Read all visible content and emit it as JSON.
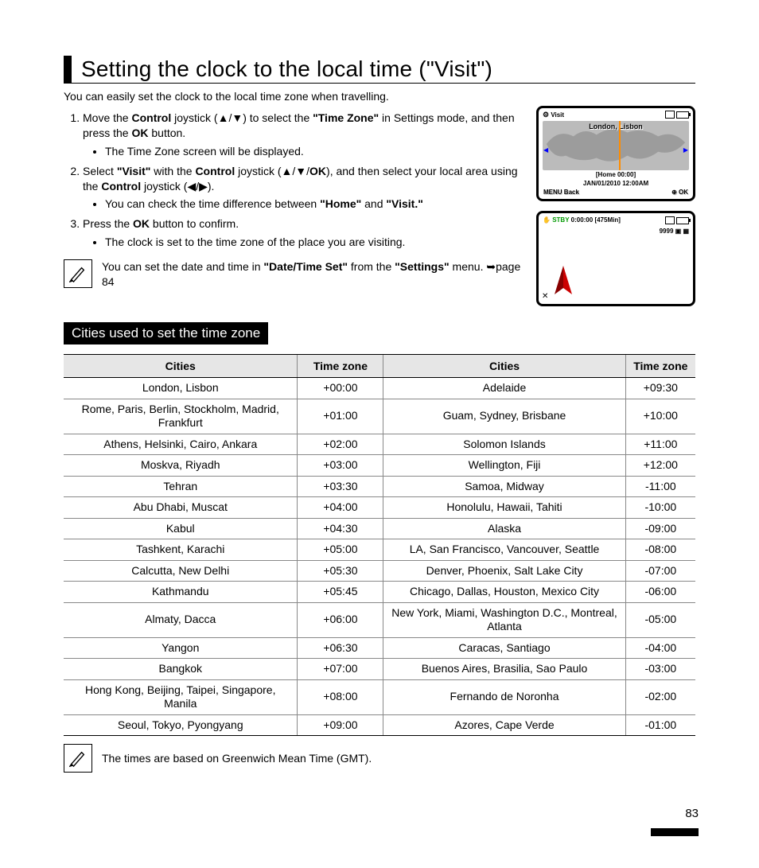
{
  "title": "Setting the clock to the local time (\"Visit\")",
  "intro": "You can easily set the clock to the local time zone when travelling.",
  "steps": {
    "s1_a": "Move the ",
    "s1_b": "Control",
    "s1_c": " joystick (▲/▼) to select the ",
    "s1_d": "\"Time Zone\"",
    "s1_e": " in Settings mode, and then press the ",
    "s1_f": "OK",
    "s1_g": " button.",
    "s1_bullet": "The Time Zone screen will be displayed.",
    "s2_a": "Select ",
    "s2_b": "\"Visit\"",
    "s2_c": " with the ",
    "s2_d": "Control",
    "s2_e": " joystick (▲/▼/",
    "s2_f": "OK",
    "s2_g": "), and then select your local area using the ",
    "s2_h": "Control",
    "s2_i": " joystick (◀/▶).",
    "s2_bullet_a": "You can check the time difference between ",
    "s2_bullet_b": "\"Home\"",
    "s2_bullet_c": " and ",
    "s2_bullet_d": "\"Visit.\"",
    "s3_a": "Press the ",
    "s3_b": "OK",
    "s3_c": " button to confirm.",
    "s3_bullet": "The clock is set to the time zone of the place you are visiting."
  },
  "note1_a": "You can set the date and time in ",
  "note1_b": "\"Date/Time Set\"",
  "note1_c": " from the ",
  "note1_d": "\"Settings\"",
  "note1_e": " menu. ➥page 84",
  "lcd1": {
    "mode": "Visit",
    "city": "London, Lisbon",
    "home": "[Home 00:00]",
    "date": "JAN/01/2010 12:00AM",
    "menu": "MENU",
    "back": "Back",
    "ok": "OK"
  },
  "lcd2": {
    "stby": "STBY",
    "time": "0:00:00",
    "remain": "[475Min]",
    "count": "9999"
  },
  "section": "Cities used to set the time zone",
  "headers": {
    "cities": "Cities",
    "tz": "Time zone"
  },
  "rows": [
    {
      "c1": "London, Lisbon",
      "t1": "+00:00",
      "c2": "Adelaide",
      "t2": "+09:30"
    },
    {
      "c1": "Rome, Paris, Berlin, Stockholm, Madrid, Frankfurt",
      "t1": "+01:00",
      "c2": "Guam, Sydney, Brisbane",
      "t2": "+10:00"
    },
    {
      "c1": "Athens, Helsinki, Cairo, Ankara",
      "t1": "+02:00",
      "c2": "Solomon Islands",
      "t2": "+11:00"
    },
    {
      "c1": "Moskva, Riyadh",
      "t1": "+03:00",
      "c2": "Wellington, Fiji",
      "t2": "+12:00"
    },
    {
      "c1": "Tehran",
      "t1": "+03:30",
      "c2": "Samoa, Midway",
      "t2": "-11:00"
    },
    {
      "c1": "Abu Dhabi, Muscat",
      "t1": "+04:00",
      "c2": "Honolulu, Hawaii, Tahiti",
      "t2": "-10:00"
    },
    {
      "c1": "Kabul",
      "t1": "+04:30",
      "c2": "Alaska",
      "t2": "-09:00"
    },
    {
      "c1": "Tashkent, Karachi",
      "t1": "+05:00",
      "c2": "LA, San Francisco, Vancouver, Seattle",
      "t2": "-08:00"
    },
    {
      "c1": "Calcutta, New Delhi",
      "t1": "+05:30",
      "c2": "Denver, Phoenix, Salt Lake City",
      "t2": "-07:00"
    },
    {
      "c1": "Kathmandu",
      "t1": "+05:45",
      "c2": "Chicago, Dallas, Houston, Mexico City",
      "t2": "-06:00"
    },
    {
      "c1": "Almaty, Dacca",
      "t1": "+06:00",
      "c2": "New York, Miami, Washington D.C., Montreal,\nAtlanta",
      "t2": "-05:00"
    },
    {
      "c1": "Yangon",
      "t1": "+06:30",
      "c2": "Caracas, Santiago",
      "t2": "-04:00"
    },
    {
      "c1": "Bangkok",
      "t1": "+07:00",
      "c2": "Buenos Aires, Brasilia, Sao Paulo",
      "t2": "-03:00"
    },
    {
      "c1": "Hong Kong, Beijing, Taipei, Singapore, Manila",
      "t1": "+08:00",
      "c2": "Fernando de Noronha",
      "t2": "-02:00"
    },
    {
      "c1": "Seoul, Tokyo, Pyongyang",
      "t1": "+09:00",
      "c2": "Azores, Cape Verde",
      "t2": "-01:00"
    }
  ],
  "note2": "The times are based on Greenwich Mean Time (GMT).",
  "page": "83"
}
